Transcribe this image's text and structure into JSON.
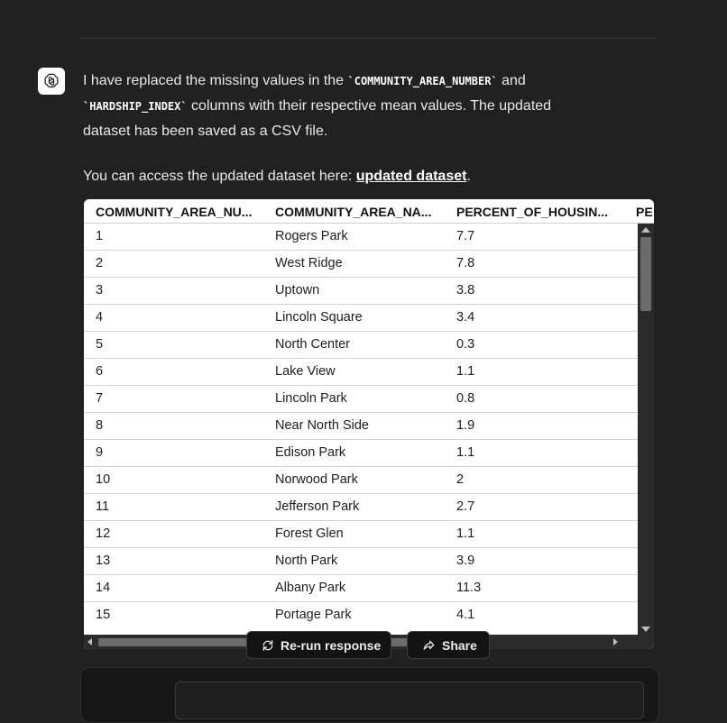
{
  "message": {
    "line1_pre": "I have replaced the missing values in the ",
    "code1": "`COMMUNITY_AREA_NUMBER`",
    "line1_mid": " and",
    "code2": "`HARDSHIP_INDEX`",
    "line1_post": " columns with their respective mean values. The updated dataset has been saved as a CSV file.",
    "line2_pre": "You can access the updated dataset here: ",
    "link_text": "updated dataset",
    "line2_post": "."
  },
  "table": {
    "headers": [
      "COMMUNITY_AREA_NU...",
      "COMMUNITY_AREA_NA...",
      "PERCENT_OF_HOUSIN...",
      "PE"
    ],
    "rows": [
      [
        "1",
        "Rogers Park",
        "7.7"
      ],
      [
        "2",
        "West Ridge",
        "7.8"
      ],
      [
        "3",
        "Uptown",
        "3.8"
      ],
      [
        "4",
        "Lincoln Square",
        "3.4"
      ],
      [
        "5",
        "North Center",
        "0.3"
      ],
      [
        "6",
        "Lake View",
        "1.1"
      ],
      [
        "7",
        "Lincoln Park",
        "0.8"
      ],
      [
        "8",
        "Near North Side",
        "1.9"
      ],
      [
        "9",
        "Edison Park",
        "1.1"
      ],
      [
        "10",
        "Norwood Park",
        "2"
      ],
      [
        "11",
        "Jefferson Park",
        "2.7"
      ],
      [
        "12",
        "Forest Glen",
        "1.1"
      ],
      [
        "13",
        "North Park",
        "3.9"
      ],
      [
        "14",
        "Albany Park",
        "11.3"
      ],
      [
        "15",
        "Portage Park",
        "4.1"
      ]
    ]
  },
  "buttons": {
    "rerun_label": "Re-run response",
    "share_label": "Share"
  },
  "icons": {
    "avatar": "openai-logo-icon",
    "rerun": "refresh-icon",
    "share": "share-arrow-icon"
  }
}
